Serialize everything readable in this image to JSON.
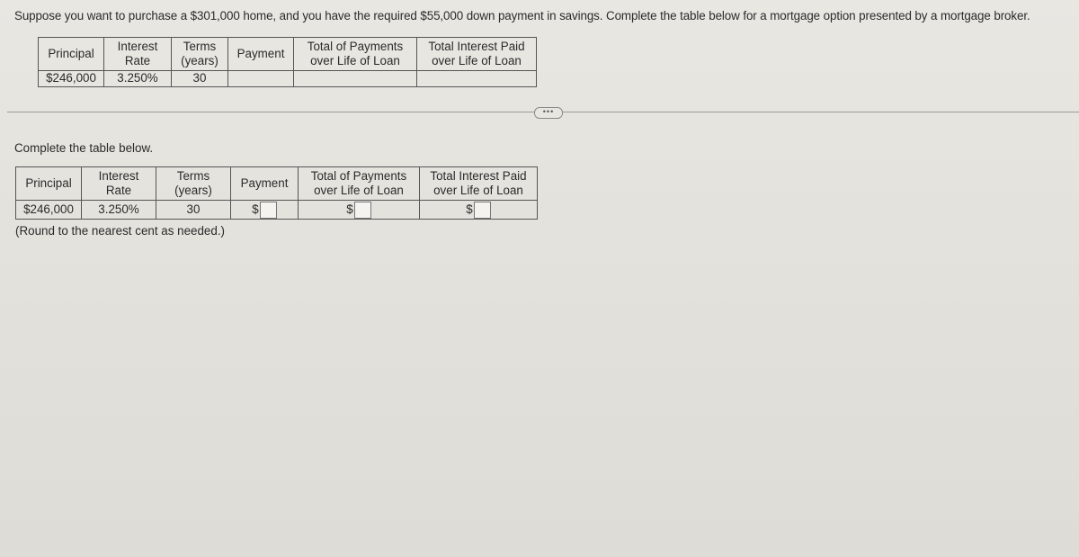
{
  "prompt": "Suppose you want to purchase a $301,000 home, and you have the required $55,000 down payment in savings. Complete the table below for a mortgage option presented by a mortgage broker.",
  "table_headers": {
    "principal": "Principal",
    "rate_line1": "Interest",
    "rate_line2": "Rate",
    "terms_line1": "Terms",
    "terms_line2": "(years)",
    "payment": "Payment",
    "total_line1": "Total of Payments",
    "total_line2": "over Life of Loan",
    "interest_line1": "Total Interest Paid",
    "interest_line2": "over Life of Loan"
  },
  "row": {
    "principal": "$246,000",
    "rate": "3.250%",
    "terms": "30"
  },
  "more_button": "•••",
  "instruction": "Complete the table below.",
  "answer": {
    "currency": "$",
    "payment": "",
    "total_payments": "",
    "total_interest": ""
  },
  "rounding_note": "(Round to the nearest cent as needed.)"
}
